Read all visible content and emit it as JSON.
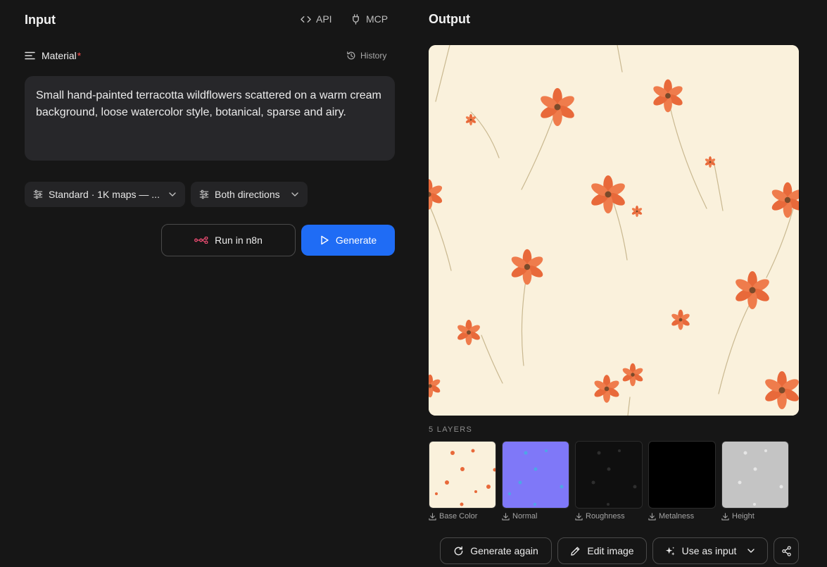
{
  "input": {
    "title": "Input",
    "api_label": "API",
    "mcp_label": "MCP",
    "material_label": "Material",
    "required_mark": "*",
    "history_label": "History",
    "prompt": "Small hand-painted terracotta wildflowers scattered on a warm cream background, loose watercolor style, botanical, sparse and airy.",
    "quality_select": "Standard · 1K maps — ...",
    "tiling_select": "Both directions",
    "run_n8n_label": "Run in n8n",
    "generate_label": "Generate"
  },
  "output": {
    "title": "Output",
    "layers_title": "5 LAYERS",
    "layers": [
      {
        "label": "Base Color",
        "icon": "download-icon"
      },
      {
        "label": "Normal",
        "icon": "download-icon"
      },
      {
        "label": "Roughness",
        "icon": "download-icon"
      },
      {
        "label": "Metalness",
        "icon": "download-icon"
      },
      {
        "label": "Height",
        "icon": "download-icon"
      }
    ],
    "actions": {
      "generate_again": "Generate again",
      "edit_image": "Edit image",
      "use_as_input": "Use as input"
    }
  },
  "colors": {
    "accent": "#1f6cf5",
    "background": "#161616",
    "card": "#27272a",
    "required": "#ff4d4d",
    "n8n": "#ea4b71",
    "flower": "#e8693a",
    "cream": "#faf1dc",
    "normal_map": "#7f78f8"
  }
}
